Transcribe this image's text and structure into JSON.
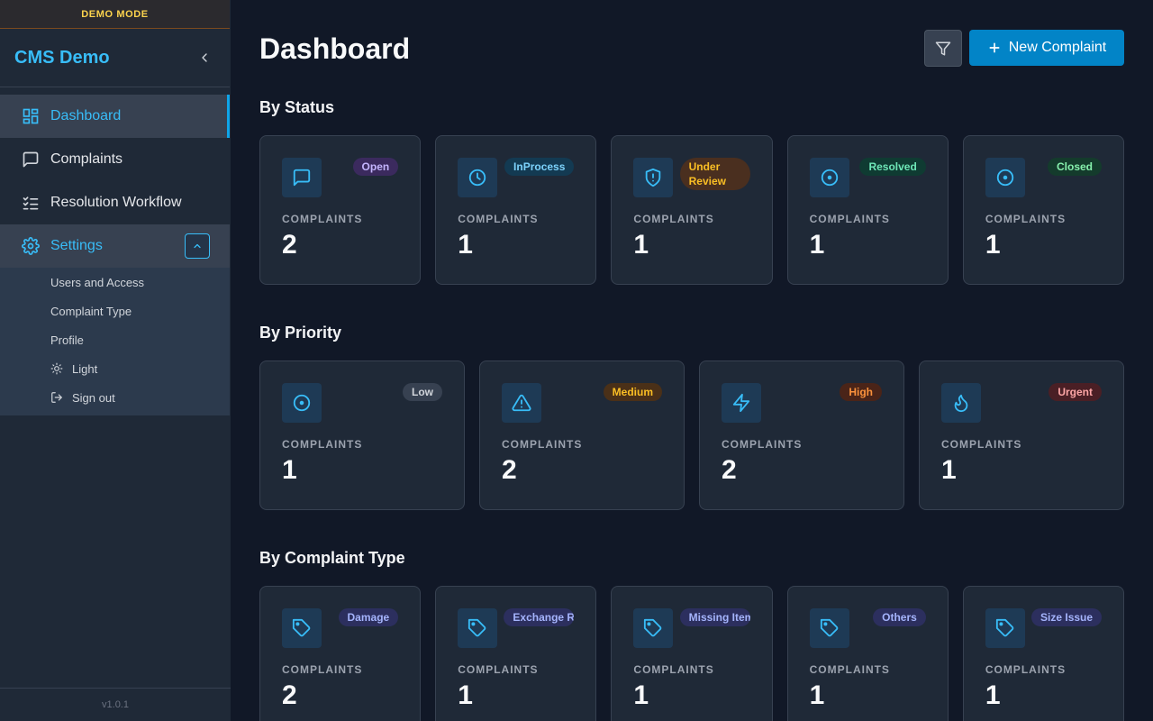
{
  "demo_banner": "DEMO MODE",
  "brand": "CMS Demo",
  "nav": {
    "dashboard": "Dashboard",
    "complaints": "Complaints",
    "workflow": "Resolution Workflow",
    "settings": "Settings"
  },
  "submenu": {
    "users": "Users and Access",
    "complaint_type": "Complaint Type",
    "profile": "Profile",
    "theme": "Light",
    "signout": "Sign out"
  },
  "version": "v1.0.1",
  "page_title": "Dashboard",
  "new_button": "New Complaint",
  "card_label": "COMPLAINTS",
  "sections": {
    "status": "By Status",
    "priority": "By Priority",
    "type": "By Complaint Type"
  },
  "status_cards": [
    {
      "badge": "Open",
      "count": "2",
      "badge_bg": "#3b2a5e",
      "badge_fg": "#c4b5fd",
      "icon": "message-icon"
    },
    {
      "badge": "InProcess",
      "count": "1",
      "badge_bg": "#133a52",
      "badge_fg": "#7dd3fc",
      "icon": "clock-icon"
    },
    {
      "badge": "Under Review",
      "count": "1",
      "badge_bg": "#4a2f1f",
      "badge_fg": "#fbbf24",
      "icon": "shield-alert-icon"
    },
    {
      "badge": "Resolved",
      "count": "1",
      "badge_bg": "#0f3b32",
      "badge_fg": "#6ee7b7",
      "icon": "target-icon"
    },
    {
      "badge": "Closed",
      "count": "1",
      "badge_bg": "#143b2c",
      "badge_fg": "#86efac",
      "icon": "target-icon"
    }
  ],
  "priority_cards": [
    {
      "badge": "Low",
      "count": "1",
      "badge_bg": "#374151",
      "badge_fg": "#d1d5db",
      "icon": "target-icon"
    },
    {
      "badge": "Medium",
      "count": "2",
      "badge_bg": "#4a3018",
      "badge_fg": "#fbbf24",
      "icon": "alert-triangle-icon"
    },
    {
      "badge": "High",
      "count": "2",
      "badge_bg": "#4a2418",
      "badge_fg": "#fb923c",
      "icon": "zap-icon"
    },
    {
      "badge": "Urgent",
      "count": "1",
      "badge_bg": "#4a1f25",
      "badge_fg": "#fca5a5",
      "icon": "flame-icon"
    }
  ],
  "type_cards": [
    {
      "badge": "Damage",
      "count": "2",
      "badge_bg": "#2c2f5e",
      "badge_fg": "#a5b4fc",
      "icon": "tag-icon"
    },
    {
      "badge": "Exchange Request",
      "count": "1",
      "badge_bg": "#2c2f5e",
      "badge_fg": "#a5b4fc",
      "icon": "tag-icon"
    },
    {
      "badge": "Missing Item",
      "count": "1",
      "badge_bg": "#2c2f5e",
      "badge_fg": "#a5b4fc",
      "icon": "tag-icon"
    },
    {
      "badge": "Others",
      "count": "1",
      "badge_bg": "#2c2f5e",
      "badge_fg": "#a5b4fc",
      "icon": "tag-icon"
    },
    {
      "badge": "Size Issue",
      "count": "1",
      "badge_bg": "#2c2f5e",
      "badge_fg": "#a5b4fc",
      "icon": "tag-icon"
    }
  ]
}
